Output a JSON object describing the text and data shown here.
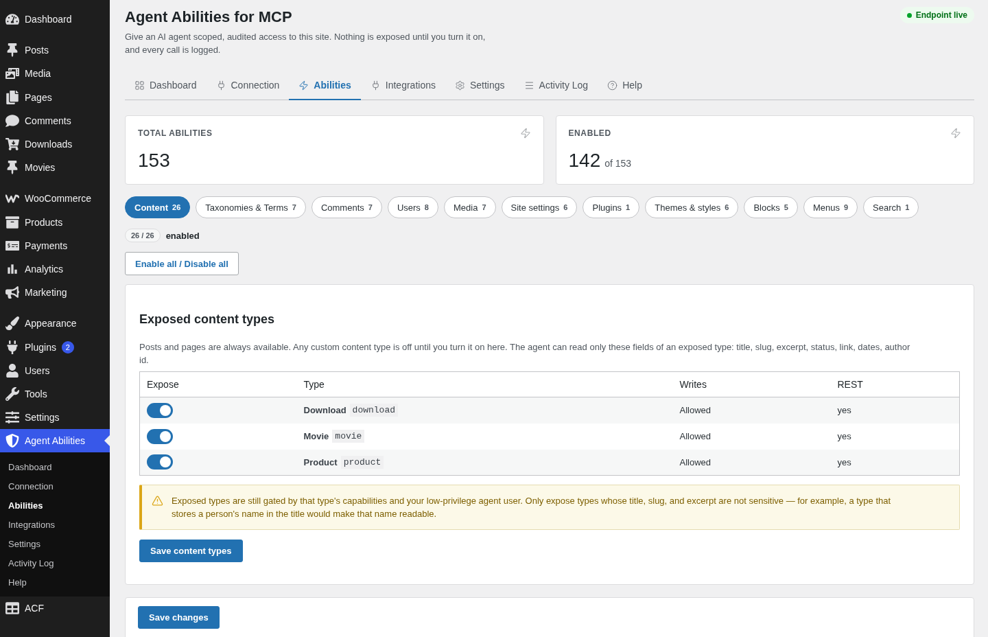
{
  "sidebar": {
    "groups": [
      {
        "items": [
          {
            "label": "Dashboard",
            "selected": false
          }
        ]
      },
      {
        "items": [
          {
            "label": "Posts",
            "selected": false
          },
          {
            "label": "Media",
            "selected": false
          },
          {
            "label": "Pages",
            "selected": false
          },
          {
            "label": "Comments",
            "selected": false
          },
          {
            "label": "Downloads",
            "selected": false
          },
          {
            "label": "Movies",
            "selected": false
          }
        ]
      },
      {
        "items": [
          {
            "label": "WooCommerce",
            "selected": false
          },
          {
            "label": "Products",
            "selected": false
          },
          {
            "label": "Payments",
            "selected": false
          },
          {
            "label": "Analytics",
            "selected": false
          },
          {
            "label": "Marketing",
            "selected": false
          }
        ]
      },
      {
        "items": [
          {
            "label": "Appearance",
            "selected": false
          },
          {
            "label": "Plugins",
            "selected": false,
            "badge": "2"
          },
          {
            "label": "Users",
            "selected": false
          },
          {
            "label": "Tools",
            "selected": false
          },
          {
            "label": "Settings",
            "selected": false
          },
          {
            "label": "Agent Abilities",
            "selected": true,
            "children": [
              {
                "label": "Dashboard",
                "selected": false
              },
              {
                "label": "Connection",
                "selected": false
              },
              {
                "label": "Abilities",
                "selected": true
              },
              {
                "label": "Integrations",
                "selected": false
              },
              {
                "label": "Settings",
                "selected": false
              },
              {
                "label": "Activity Log",
                "selected": false
              },
              {
                "label": "Help",
                "selected": false
              }
            ]
          },
          {
            "label": "ACF",
            "selected": false
          }
        ]
      }
    ]
  },
  "header": {
    "title": "Agent Abilities for MCP",
    "description": "Give an AI agent scoped, audited access to this site. Nothing is exposed until you turn it on, and every call is logged.",
    "status": {
      "label": "Endpoint live",
      "live": true
    }
  },
  "tabs": [
    {
      "label": "Dashboard",
      "selected": false
    },
    {
      "label": "Connection",
      "selected": false
    },
    {
      "label": "Abilities",
      "selected": true
    },
    {
      "label": "Integrations",
      "selected": false
    },
    {
      "label": "Settings",
      "selected": false
    },
    {
      "label": "Activity Log",
      "selected": false
    },
    {
      "label": "Help",
      "selected": false
    }
  ],
  "stats": [
    {
      "label": "TOTAL ABILITIES",
      "value": "153"
    },
    {
      "label": "ENABLED",
      "value": "142",
      "total": "of 153"
    }
  ],
  "categories": [
    {
      "label": "Content",
      "count": "26",
      "selected": true
    },
    {
      "label": "Taxonomies & Terms",
      "count": "7",
      "selected": false
    },
    {
      "label": "Comments",
      "count": "7",
      "selected": false
    },
    {
      "label": "Users",
      "count": "8",
      "selected": false
    },
    {
      "label": "Media",
      "count": "7",
      "selected": false
    },
    {
      "label": "Site settings",
      "count": "6",
      "selected": false
    },
    {
      "label": "Plugins",
      "count": "1",
      "selected": false
    },
    {
      "label": "Themes & styles",
      "count": "6",
      "selected": false
    },
    {
      "label": "Blocks",
      "count": "5",
      "selected": false
    },
    {
      "label": "Menus",
      "count": "9",
      "selected": false
    },
    {
      "label": "Search",
      "count": "1",
      "selected": false
    }
  ],
  "summary": {
    "count": "26 / 26",
    "label": "enabled"
  },
  "bulk_button": "Enable all / Disable all",
  "content_types": {
    "title": "Exposed content types",
    "description": "Posts and pages are always available. Any custom content type is off until you turn it on here. The agent can read only these fields of an exposed type: title, slug, excerpt, status, link, dates, author id.",
    "table": {
      "columns": [
        "Expose",
        "Type",
        "Writes",
        "REST"
      ],
      "rows": [
        {
          "exposed": true,
          "name": "Download",
          "slug": "download",
          "writes": "Allowed",
          "rest": "yes"
        },
        {
          "exposed": true,
          "name": "Movie",
          "slug": "movie",
          "writes": "Allowed",
          "rest": "yes"
        },
        {
          "exposed": true,
          "name": "Product",
          "slug": "product",
          "writes": "Allowed",
          "rest": "yes"
        }
      ]
    },
    "notice": "Exposed types are still gated by that type's capabilities and your low-privilege agent user. Only expose types whose title, slug, and excerpt are not sensitive — for example, a type that stores a person's name in the title would make that name readable.",
    "save_button": "Save content types"
  },
  "footer": {
    "save_button": "Save changes"
  }
}
